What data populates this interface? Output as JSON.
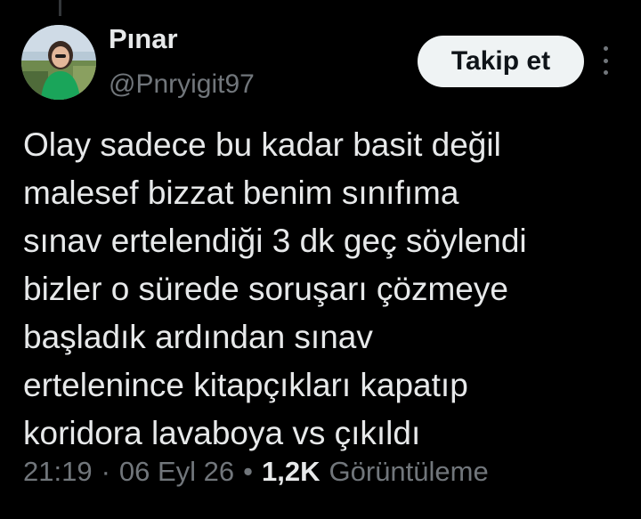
{
  "author": {
    "display_name": "Pınar",
    "handle": "@Pnryigit97"
  },
  "actions": {
    "follow_label": "Takip et",
    "more_icon": "more-vertical-icon"
  },
  "tweet": {
    "lines": [
      "Olay sadece bu kadar basit değil",
      "malesef bizzat benim sınıfıma",
      "sınav ertelendiği 3 dk geç söylendi",
      "bizler o sürede soruşarı çözmeye",
      "başladık ardından sınav",
      "ertelenince kitapçıkları kapatıp",
      "koridora lavaboya vs çıkıldı"
    ]
  },
  "meta": {
    "time": "21:19",
    "separator1": "·",
    "date": "06 Eyl 26",
    "separator2": "•",
    "views_count": "1,2K",
    "views_label": "Görüntüleme"
  },
  "colors": {
    "background": "#000000",
    "text_primary": "#e7e9ea",
    "text_secondary": "#71767b",
    "button_bg": "#eff3f4",
    "button_text": "#0f1419"
  }
}
